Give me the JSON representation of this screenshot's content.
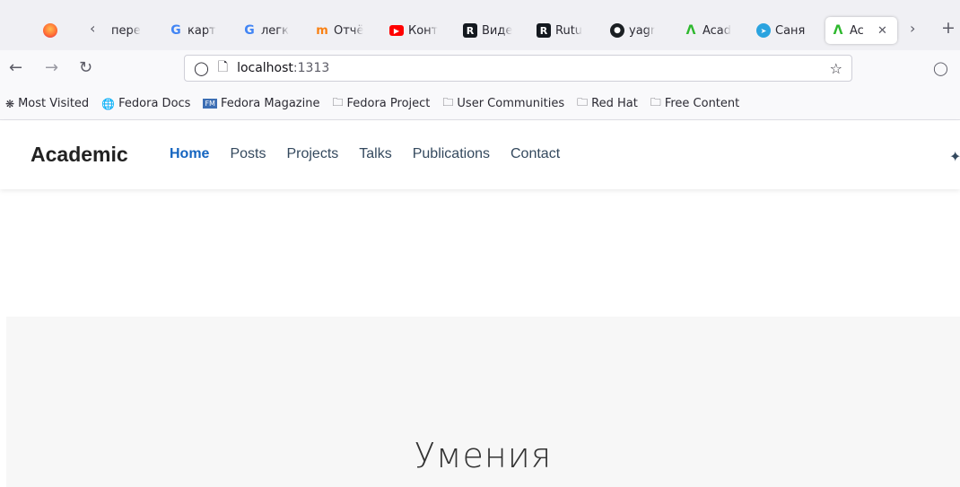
{
  "tabs": [
    {
      "label": "пере",
      "icon": "firefox-view-icon"
    },
    {
      "label": "карт",
      "icon": "google-icon"
    },
    {
      "label": "легк",
      "icon": "google-icon"
    },
    {
      "label": "Отчё",
      "icon": "moodle-icon"
    },
    {
      "label": "Конт",
      "icon": "youtube-icon"
    },
    {
      "label": "Виде",
      "icon": "rutube-icon"
    },
    {
      "label": "Rutu",
      "icon": "rutube-icon"
    },
    {
      "label": "yagr",
      "icon": "github-icon"
    },
    {
      "label": "Acad",
      "icon": "academic-icon"
    },
    {
      "label": "Саня",
      "icon": "telegram-icon"
    },
    {
      "label": "Ac",
      "icon": "academic-icon",
      "active": true
    }
  ],
  "addressbar": {
    "host": "localhost",
    "port": ":1313"
  },
  "bookmarks": [
    {
      "label": "Most Visited",
      "icon": "gear-icon"
    },
    {
      "label": "Fedora Docs",
      "icon": "globe-icon"
    },
    {
      "label": "Fedora Magazine",
      "icon": "fedora-magazine-icon"
    },
    {
      "label": "Fedora Project",
      "icon": "folder-icon"
    },
    {
      "label": "User Communities",
      "icon": "folder-icon"
    },
    {
      "label": "Red Hat",
      "icon": "folder-icon"
    },
    {
      "label": "Free Content",
      "icon": "folder-icon"
    }
  ],
  "site": {
    "brand": "Academic",
    "menu": [
      "Home",
      "Posts",
      "Projects",
      "Talks",
      "Publications",
      "Contact"
    ],
    "active_menu": "Home",
    "section_title": "Умения"
  }
}
